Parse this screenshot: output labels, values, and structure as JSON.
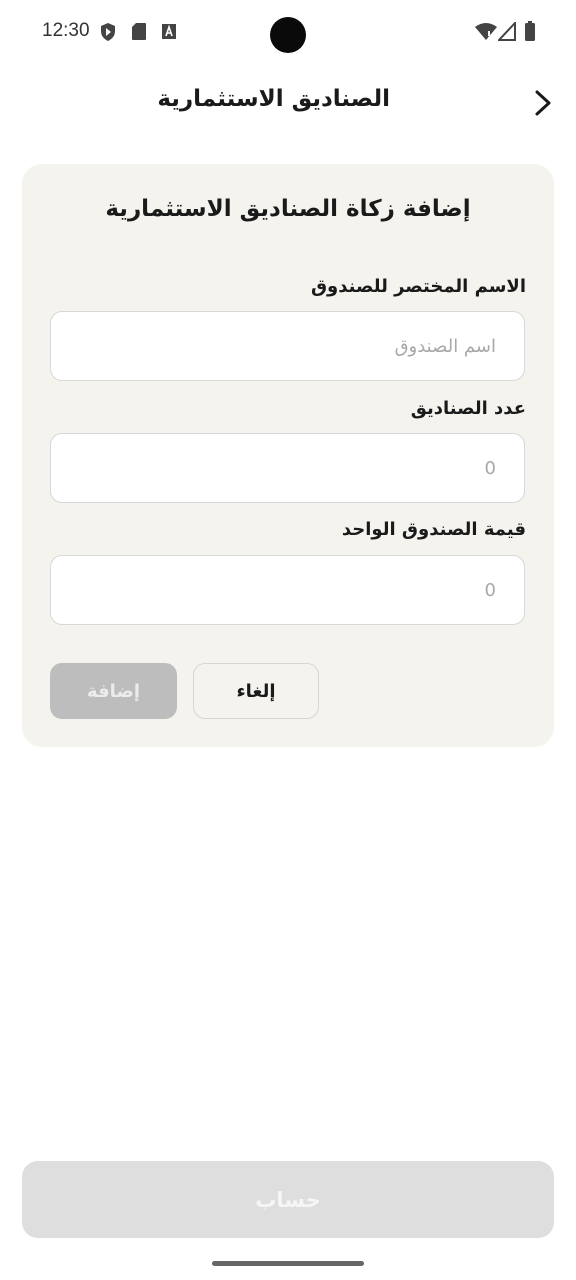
{
  "status_bar": {
    "time": "12:30",
    "icons": [
      "shield-play-icon",
      "sd-card-icon",
      "font-a-icon",
      "wifi-icon",
      "cell-signal-icon",
      "battery-icon"
    ]
  },
  "app_bar": {
    "title": "الصناديق الاستثمارية",
    "back_icon": "chevron-right-icon"
  },
  "card": {
    "title": "إضافة زكاة الصناديق الاستثمارية",
    "fields": [
      {
        "label": "الاسم المختصر للصندوق",
        "placeholder": "اسم الصندوق",
        "value": ""
      },
      {
        "label": "عدد الصناديق",
        "placeholder": "0",
        "value": ""
      },
      {
        "label": "قيمة الصندوق الواحد",
        "placeholder": "0",
        "value": ""
      }
    ],
    "cancel_label": "إلغاء",
    "add_label": "إضافة"
  },
  "calculate_label": "حساب",
  "colors": {
    "card_bg": "#f4f3ee",
    "disabled_button": "#bdbdbd",
    "calculate_disabled": "#dedede"
  }
}
